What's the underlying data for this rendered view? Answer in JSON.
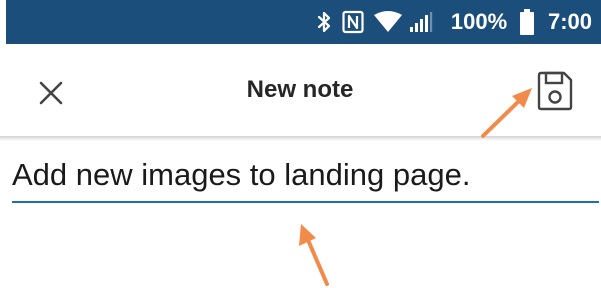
{
  "status_bar": {
    "background_color": "#1c4e7b",
    "icons": [
      "bluetooth-icon",
      "nfc-icon",
      "wifi-icon",
      "signal-icon",
      "battery-icon"
    ],
    "battery_percent": "100%",
    "time": "7:00"
  },
  "app_bar": {
    "close_icon": "close-icon",
    "title": "New note",
    "save_icon": "save-icon"
  },
  "note": {
    "value": "Add new images to landing page.",
    "underline_color": "#1d6fad"
  },
  "annotations": {
    "arrow_color": "#f28a4a",
    "arrows": [
      "save-button-arrow",
      "note-field-arrow"
    ]
  }
}
